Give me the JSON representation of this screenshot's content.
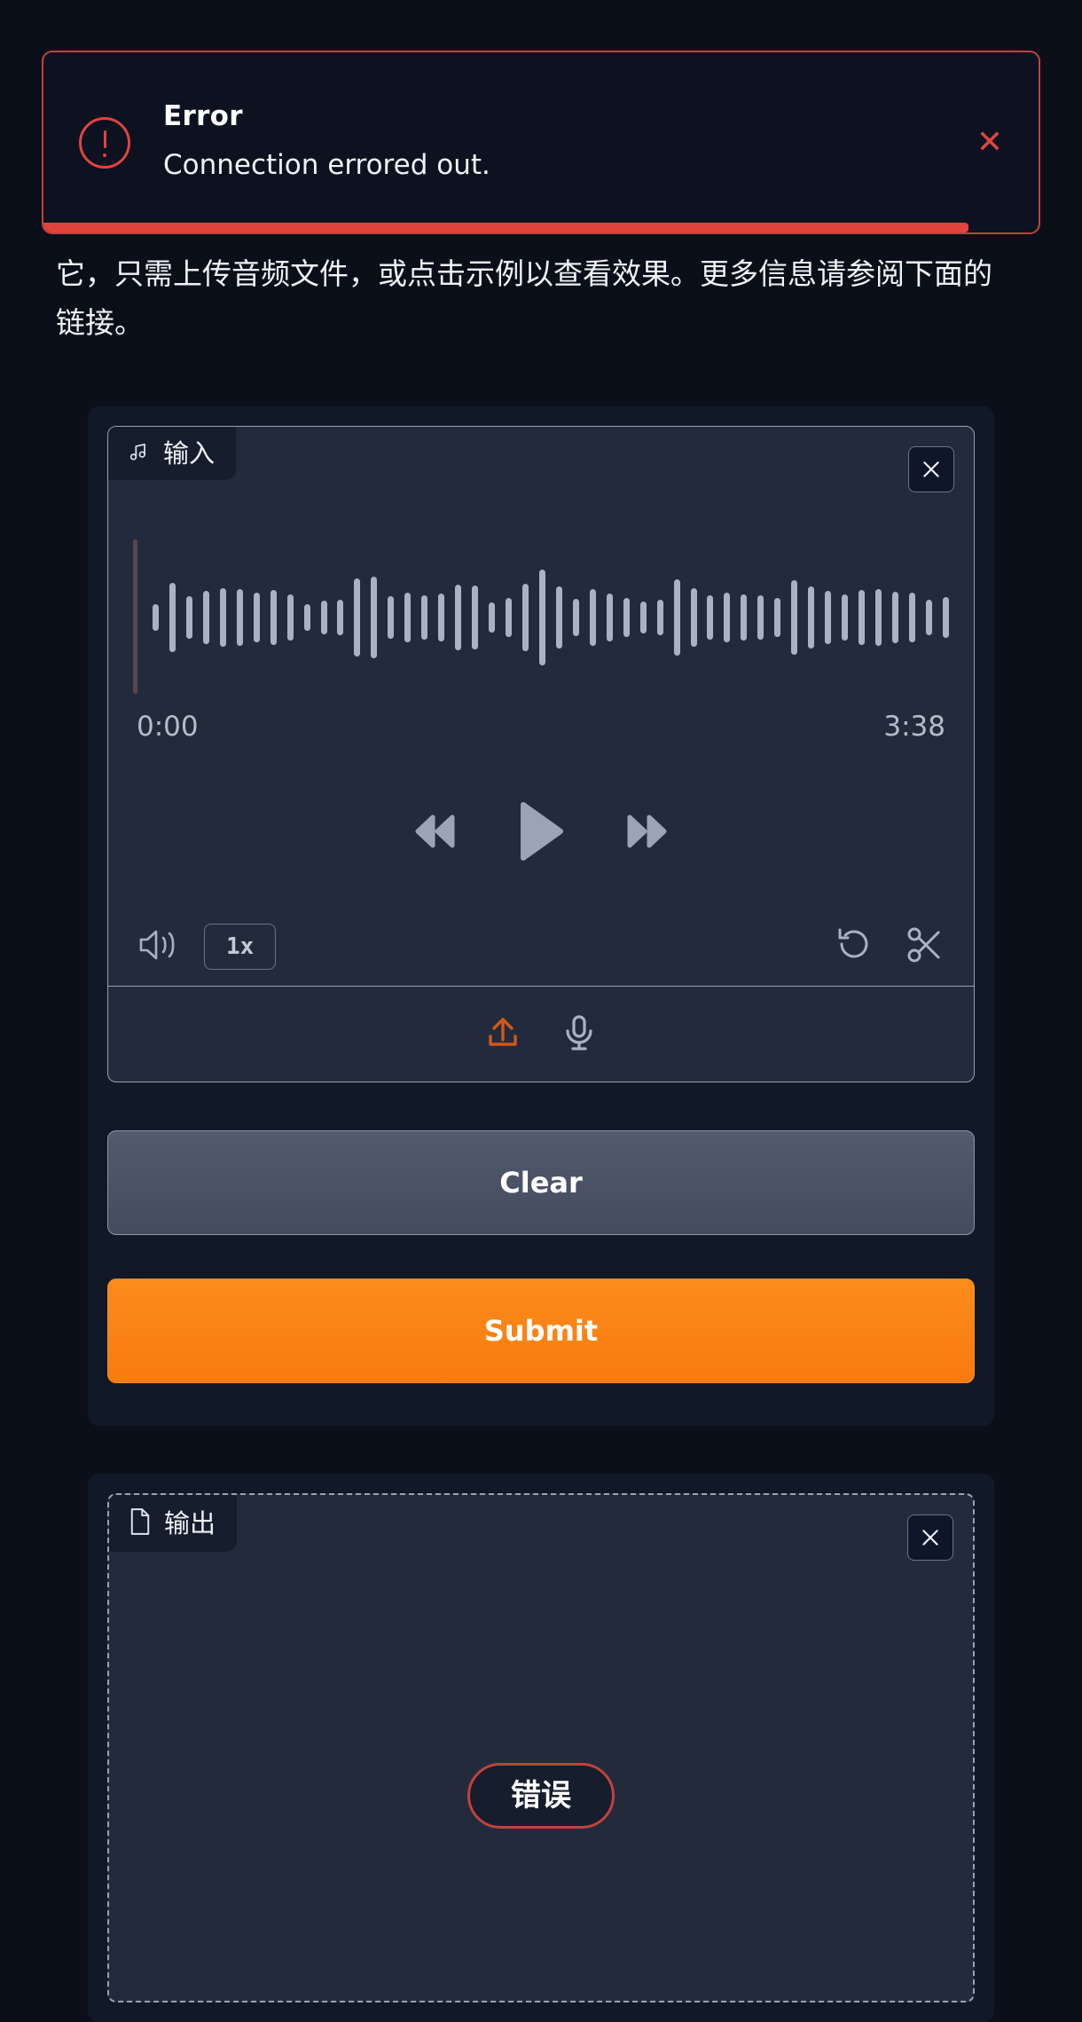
{
  "toast": {
    "title": "Error",
    "message": "Connection errored out.",
    "close_label": "✕",
    "icon": "alert-circle-icon",
    "accent_color": "#e0443e"
  },
  "description": {
    "text": "它，只需上传音频文件，或点击示例以查看效果。更多信息请参阅下面的链接。"
  },
  "input_panel": {
    "tab_label": "输入",
    "tab_icon": "music-note-icon",
    "close_icon": "close-icon",
    "current_time": "0:00",
    "total_time": "3:38",
    "speed": "1x",
    "controls": {
      "rewind": "rewind-icon",
      "play": "play-icon",
      "forward": "fast-forward-icon",
      "volume": "volume-icon",
      "reset": "undo-icon",
      "trim": "scissors-icon",
      "upload": "upload-icon",
      "record": "microphone-icon"
    },
    "waveform": [
      30,
      78,
      48,
      60,
      66,
      64,
      56,
      62,
      52,
      30,
      38,
      40,
      88,
      92,
      48,
      56,
      50,
      54,
      74,
      72,
      34,
      44,
      76,
      108,
      70,
      42,
      64,
      54,
      44,
      36,
      40,
      86,
      66,
      50,
      56,
      52,
      50,
      44,
      84,
      70,
      60,
      52,
      62,
      64,
      58,
      56,
      40,
      46
    ]
  },
  "buttons": {
    "clear": "Clear",
    "submit": "Submit",
    "submit_color": "#f97b0d"
  },
  "output_panel": {
    "tab_label": "输出",
    "tab_icon": "file-icon",
    "close_icon": "close-icon",
    "status_badge": "错误",
    "status_color": "#c2413c"
  }
}
